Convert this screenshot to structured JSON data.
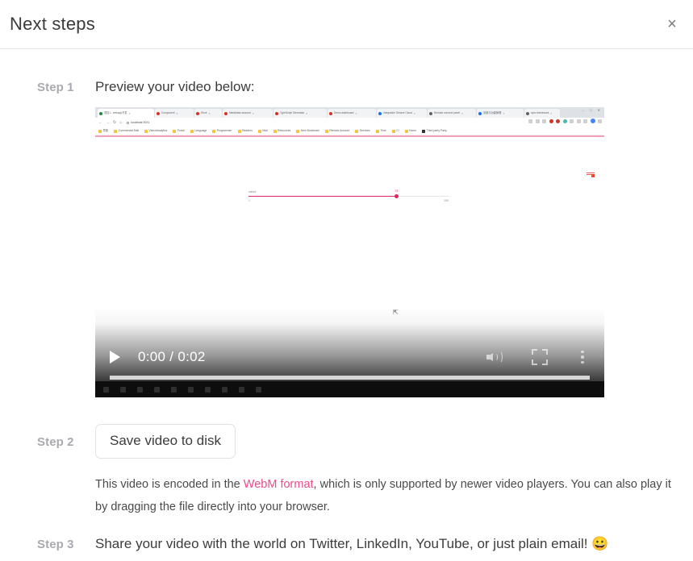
{
  "header": {
    "title": "Next steps",
    "close_label": "×"
  },
  "steps": {
    "step1": {
      "label": "Step 1",
      "heading": "Preview your video below:"
    },
    "step2": {
      "label": "Step 2",
      "button_label": "Save video to disk",
      "note_before": "This video is encoded in the ",
      "note_link": "WebM format",
      "note_after": ", which is only supported by newer video players. You can also play it by dragging the file directly into your browser."
    },
    "step3": {
      "label": "Step 3",
      "text": "Share your video with the world on Twitter, LinkedIn, YouTube, or just plain email! ",
      "emoji": "😀"
    }
  },
  "video": {
    "current_time": "0:00",
    "duration": "0:02",
    "time_display": "0:00 / 0:02",
    "progress_percent": 0,
    "play_icon": "play-icon",
    "volume_icon": "volume-icon",
    "fullscreen_icon": "fullscreen-icon",
    "more_icon": "kebab-menu-icon",
    "content": {
      "tabs": [
        {
          "title": "项目1 - webapp开发",
          "favicon_color": "#1e8e3e",
          "active": true
        },
        {
          "title": "Component",
          "favicon_color": "#d93025",
          "active": false
        },
        {
          "title": "Store",
          "favicon_color": "#d93025",
          "active": false
        },
        {
          "title": "MetaMask account",
          "favicon_color": "#d93025",
          "active": false
        },
        {
          "title": "TypeScript Generator",
          "favicon_color": "#d93025",
          "active": false
        },
        {
          "title": "Demo dashboard",
          "favicon_color": "#d93025",
          "active": false
        },
        {
          "title": "Integration Service Cloud",
          "favicon_color": "#1a73e8",
          "active": false
        },
        {
          "title": "Remote connect panel",
          "favicon_color": "#5f6368",
          "active": false
        },
        {
          "title": "设置与功能管理",
          "favicon_color": "#1a73e8",
          "active": false
        },
        {
          "title": "sync framework",
          "favicon_color": "#5f6368",
          "active": false
        }
      ],
      "url": "localhost:3031",
      "bookmarks": [
        "导航",
        "Commercial Mail",
        "VisionAnalytics",
        "Portal",
        "Language",
        "Programmer",
        "Readers",
        "Mail",
        "Resources",
        "New Bookmark",
        "Remote Account",
        "Services",
        "Time",
        "CI",
        "Home",
        "Third-party Party"
      ],
      "slider": {
        "field_label": "value",
        "min_label": "1",
        "max_label": "100",
        "current_value": "74",
        "fill_percent": 74,
        "accent_color": "#e0245e"
      },
      "recording_indicator": "recording-indicator"
    }
  },
  "colors": {
    "accent_pink": "#ea4c89",
    "step_label": "#a9a9b0",
    "text": "#3c3c3c",
    "border": "#e6e6e6"
  }
}
